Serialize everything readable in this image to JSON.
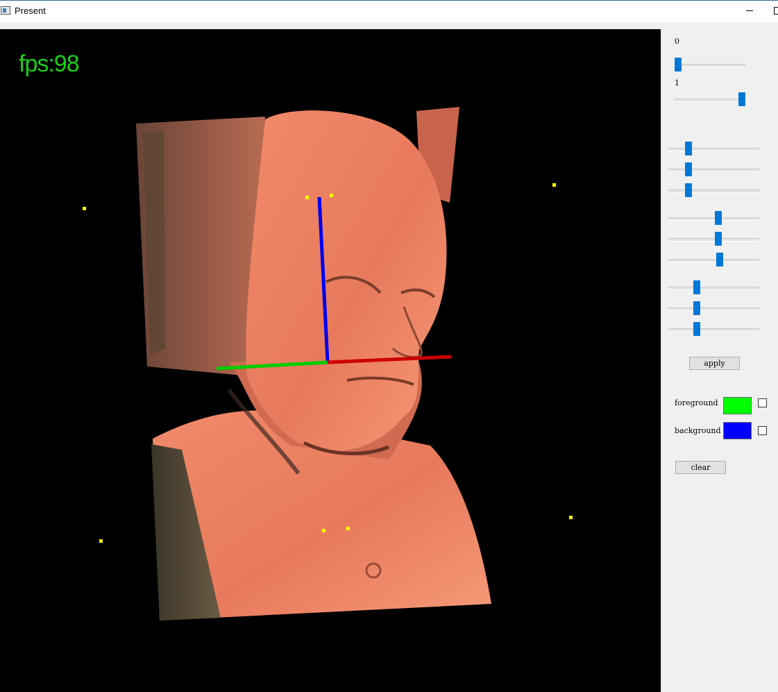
{
  "window": {
    "title": "Present"
  },
  "viewport": {
    "fps_label": "fps:98",
    "axes_colors": {
      "x": "#cc0000",
      "y": "#00cc00",
      "z": "#0000ee"
    },
    "marker_color": "#ffff00"
  },
  "panel": {
    "top_slider_1": {
      "label": "0",
      "value": 0.0
    },
    "top_slider_2": {
      "label": "1",
      "value": 1.0
    },
    "slider_groups": [
      [
        0.2,
        0.2,
        0.2
      ],
      [
        0.55,
        0.55,
        0.57
      ],
      [
        0.3,
        0.3,
        0.3
      ]
    ],
    "apply_label": "apply",
    "foreground": {
      "label": "foreground",
      "color": "#00ff00",
      "checked": false
    },
    "background": {
      "label": "background",
      "color": "#0000ff",
      "checked": false
    },
    "clear_label": "clear"
  }
}
